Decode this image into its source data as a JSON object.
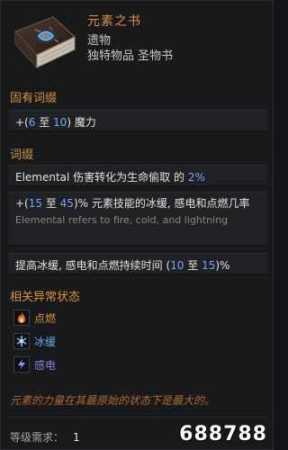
{
  "item": {
    "name": "元素之书",
    "type": "遗物",
    "subtype": "独特物品 圣物书"
  },
  "implicit": {
    "title": "固有词缀",
    "prefix": "+(",
    "min": "6",
    "sep": " 至 ",
    "max": "10",
    "suffix": ") 魔力"
  },
  "affixes": {
    "title": "词缀",
    "a1": {
      "text": "Elemental 伤害转化为生命偷取 的 ",
      "value": "2%"
    },
    "a2": {
      "prefix": "+(",
      "min": "15",
      "sep": " 至 ",
      "max": "45",
      "suffix": ")% 元素技能的冰缓, 感电和点燃几率",
      "note": "Elemental refers to fire, cold, and lightning"
    },
    "a3": {
      "text": "提高冰缓, 感电和点燃持续时间 (",
      "min": "10",
      "sep": " 至 ",
      "max": "15",
      "suffix": ")%"
    }
  },
  "statuses": {
    "title": "相关异常状态",
    "items": [
      {
        "label": "点燃",
        "icon": "fire-icon",
        "color": "#d8923a"
      },
      {
        "label": "冰缓",
        "icon": "ice-icon",
        "color": "#5fa8e8"
      },
      {
        "label": "感电",
        "icon": "lightning-icon",
        "color": "#8b7fe8"
      }
    ]
  },
  "flavor": "元素的力量在其最原始的状态下是最大的。",
  "requirement": {
    "label": "等级需求：",
    "value": "1"
  },
  "watermark": "688788",
  "colors": {
    "accent_orange": "#d8923a",
    "value_blue": "#6fa8ff",
    "background": "#18191b"
  }
}
